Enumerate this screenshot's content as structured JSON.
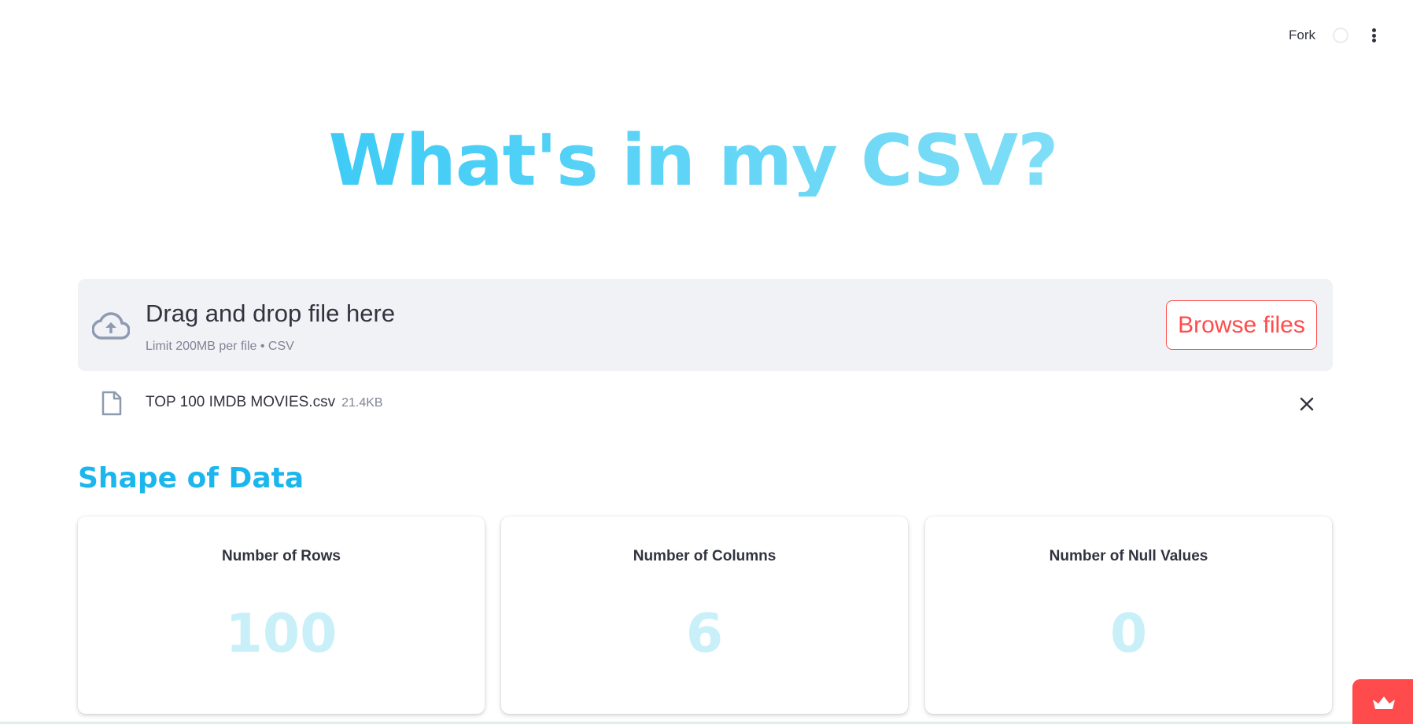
{
  "header": {
    "fork_label": "Fork",
    "github_icon": "github-icon",
    "menu_icon": "vertical-ellipsis-icon"
  },
  "title": "What's in my CSV?",
  "colors": {
    "title_gradient": [
      "#1ec3f5",
      "#9ae6f8"
    ],
    "section_title": "#1bb6ee",
    "accent": "#ff4b4b",
    "metric_value": "#c9f0f9",
    "uploader_bg": "#f0f2f6"
  },
  "uploader": {
    "icon": "cloud-upload-icon",
    "title": "Drag and drop file here",
    "limit": "Limit 200MB per file • CSV",
    "browse_label": "Browse files"
  },
  "file": {
    "icon": "file-icon",
    "name": "TOP 100 IMDB MOVIES.csv",
    "size": "21.4KB",
    "remove_icon": "close-icon"
  },
  "section": {
    "title": "Shape of Data"
  },
  "metrics": [
    {
      "label": "Number of Rows",
      "value": "100"
    },
    {
      "label": "Number of Columns",
      "value": "6"
    },
    {
      "label": "Number of Null Values",
      "value": "0"
    }
  ],
  "badge": {
    "icon": "crown-icon"
  }
}
